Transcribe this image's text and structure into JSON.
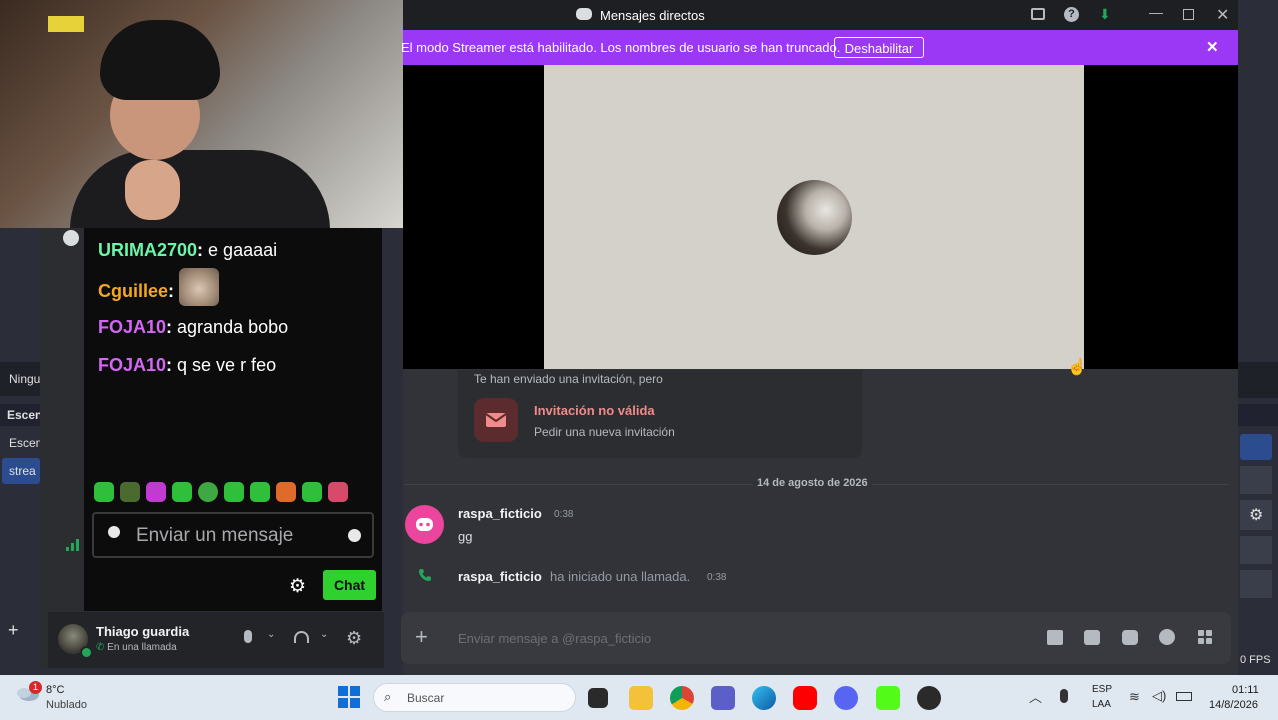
{
  "background_app": {
    "labels": [
      "Ningu",
      "Escen",
      "Escen",
      "strea"
    ],
    "fps_text": "0 FPS"
  },
  "chat": {
    "messages": [
      {
        "user": "URIMA2700",
        "text": "e gaaaai",
        "color": "#6bf5a8"
      },
      {
        "user": "Cguillee",
        "text": "",
        "color": "#f5a81e"
      },
      {
        "user": "FOJA10",
        "text": "agranda bobo",
        "color": "#d266f5"
      },
      {
        "user": "FOJA10",
        "text": "q se ve r feo",
        "color": "#d266f5"
      }
    ],
    "input_placeholder": "Enviar un mensaje",
    "send_label": "Chat"
  },
  "discord": {
    "window_title": "Mensajes directos",
    "streamer_banner": {
      "text": "El modo Streamer está habilitado. Los nombres de usuario se han truncado.",
      "button": "Deshabilitar"
    },
    "invite": {
      "header": "Te han enviado una invitación, pero",
      "title": "Invitación no válida",
      "subtitle": "Pedir una nueva invitación"
    },
    "date_divider": "14 de agosto de 2026",
    "message": {
      "author": "raspa_ficticio",
      "time": "0:38",
      "text": "gg"
    },
    "call": {
      "author": "raspa_ficticio",
      "text": "ha iniciado una llamada.",
      "time": "0:38"
    },
    "composer_placeholder": "Enviar mensaje a @raspa_ficticio",
    "user_panel": {
      "name": "Thiago guardia",
      "status": "En una llamada"
    }
  },
  "taskbar": {
    "weather_temp": "8°C",
    "weather_desc": "Nublado",
    "search_placeholder": "Buscar",
    "lang_top": "ESP",
    "lang_bottom": "LAA",
    "time": "01:11",
    "date": "14/8/2026",
    "weather_badge": "1"
  },
  "colors": {
    "streamer_purple": "#9b38f5",
    "discord_bg": "#313338",
    "chat_button_green": "#2fd12f",
    "link_red": "#f08b8b"
  }
}
